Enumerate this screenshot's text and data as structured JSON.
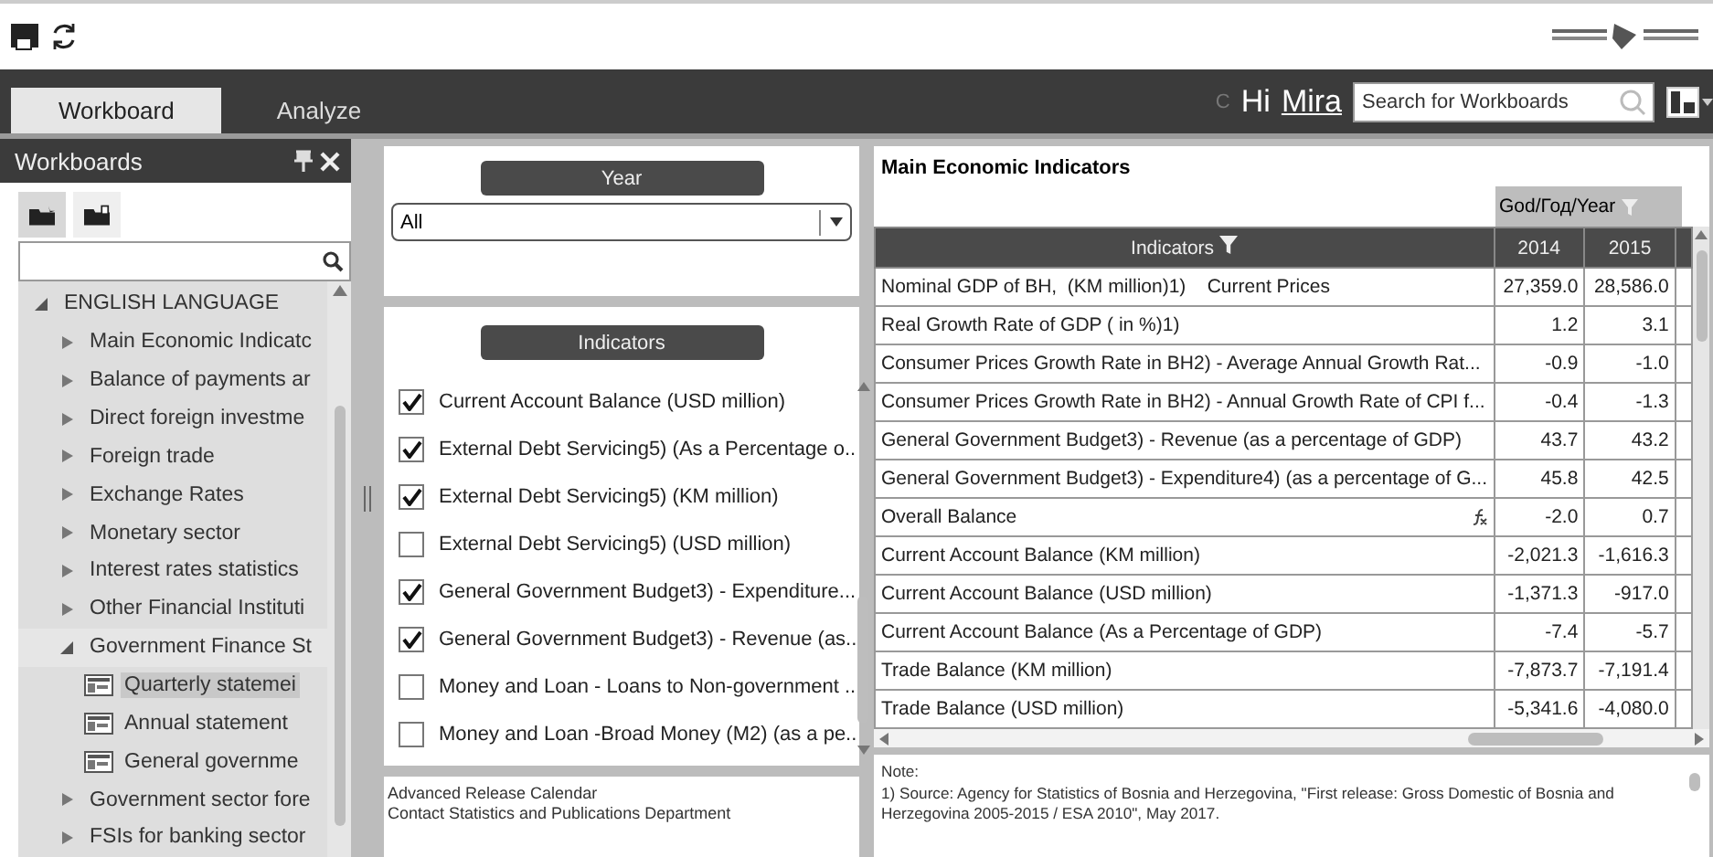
{
  "app_bar": {
    "tabs": [
      {
        "label": "Workboard",
        "selected": true
      },
      {
        "label": "Analyze",
        "selected": false
      }
    ],
    "letter": "C",
    "greeting": "Hi",
    "user": "Mira",
    "search": {
      "placeholder": "Search for Workboards"
    }
  },
  "sidebar": {
    "title": "Workboards",
    "tool_tabs": [
      {
        "selected": true
      },
      {
        "selected": false
      }
    ],
    "tree": [
      {
        "label": "ENGLISH LANGUAGE",
        "kind": "folder",
        "expanded": true,
        "selected": false,
        "children": [
          {
            "label": "Main Economic Indicatc",
            "kind": "folder",
            "expanded": false,
            "selected": false
          },
          {
            "label": "Balance of payments ar",
            "kind": "folder",
            "expanded": false,
            "selected": false
          },
          {
            "label": "Direct foreign investme",
            "kind": "folder",
            "expanded": false,
            "selected": false
          },
          {
            "label": "Foreign trade",
            "kind": "folder",
            "expanded": false,
            "selected": false
          },
          {
            "label": "Exchange Rates",
            "kind": "folder",
            "expanded": false,
            "selected": false
          },
          {
            "label": "Monetary sector",
            "kind": "folder",
            "expanded": false,
            "selected": false
          },
          {
            "label": "Interest rates statistics",
            "kind": "folder",
            "expanded": false,
            "selected": false
          },
          {
            "label": "Other Financial Instituti",
            "kind": "folder",
            "expanded": false,
            "selected": false
          },
          {
            "label": "Government Finance St",
            "kind": "folder",
            "expanded": true,
            "selected": false,
            "children": [
              {
                "label": "Quarterly statemei",
                "kind": "report",
                "selected": true
              },
              {
                "label": "Annual statement",
                "kind": "report",
                "selected": false
              },
              {
                "label": "General governme",
                "kind": "report",
                "selected": false
              }
            ]
          },
          {
            "label": "Government sector fore",
            "kind": "folder",
            "expanded": false,
            "selected": false
          },
          {
            "label": "FSIs for banking sector",
            "kind": "folder",
            "expanded": false,
            "selected": false
          }
        ]
      }
    ]
  },
  "year_filter": {
    "title": "Year",
    "value": "All"
  },
  "indicator_filter": {
    "title": "Indicators",
    "items": [
      {
        "label": "Current Account Balance (USD million)",
        "checked": true
      },
      {
        "label": "External Debt Servicing5) (As a Percentage o..",
        "checked": true
      },
      {
        "label": "External Debt Servicing5) (KM million)",
        "checked": true
      },
      {
        "label": "External Debt Servicing5) (USD million)",
        "checked": false
      },
      {
        "label": "General Government Budget3) - Expenditure...",
        "checked": true
      },
      {
        "label": "General Government Budget3) - Revenue (as..",
        "checked": true
      },
      {
        "label": "Money and Loan - Loans to Non-government ..",
        "checked": false
      },
      {
        "label": "Money and Loan -Broad Money (M2) (as a pe..",
        "checked": false
      }
    ]
  },
  "links": [
    "Advanced Release Calendar",
    "Contact Statistics and Publications Department"
  ],
  "report": {
    "title": "Main Economic Indicators",
    "column_group": "God/Год/Year",
    "columns": [
      "Indicators",
      "2014",
      "2015"
    ],
    "rows": [
      {
        "label": "Nominal GDP of BH,  (KM million)1)    Current Prices",
        "formula": false,
        "values": [
          "27,359.0",
          "28,586.0"
        ]
      },
      {
        "label": "Real Growth Rate of GDP ( in %)1)",
        "formula": false,
        "values": [
          "1.2",
          "3.1"
        ]
      },
      {
        "label": "Consumer Prices Growth Rate in BH2) - Average Annual Growth Rat...",
        "formula": false,
        "values": [
          "-0.9",
          "-1.0"
        ]
      },
      {
        "label": "Consumer Prices Growth Rate in BH2) - Annual Growth Rate of CPI f...",
        "formula": false,
        "values": [
          "-0.4",
          "-1.3"
        ]
      },
      {
        "label": "General Government Budget3) - Revenue (as a percentage of GDP)",
        "formula": false,
        "values": [
          "43.7",
          "43.2"
        ]
      },
      {
        "label": "General Government Budget3) - Expenditure4) (as a percentage of G...",
        "formula": false,
        "values": [
          "45.8",
          "42.5"
        ]
      },
      {
        "label": "Overall Balance",
        "formula": true,
        "values": [
          "-2.0",
          "0.7"
        ]
      },
      {
        "label": "Current Account Balance (KM million)",
        "formula": false,
        "values": [
          "-2,021.3",
          "-1,616.3"
        ]
      },
      {
        "label": "Current Account Balance (USD million)",
        "formula": false,
        "values": [
          "-1,371.3",
          "-917.0"
        ]
      },
      {
        "label": "Current Account Balance (As a Percentage of GDP)",
        "formula": false,
        "values": [
          "-7.4",
          "-5.7"
        ]
      },
      {
        "label": "Trade Balance (KM million)",
        "formula": false,
        "values": [
          "-7,873.7",
          "-7,191.4"
        ]
      },
      {
        "label": "Trade Balance (USD million)",
        "formula": false,
        "values": [
          "-5,341.6",
          "-4,080.0"
        ]
      }
    ],
    "note_title": "Note:",
    "note": "1) Source: Agency for Statistics of Bosnia and Herzegovina, \"First release: Gross Domestic of Bosnia and Herzegovina 2005-2015 / ESA 2010\", May 2017."
  }
}
